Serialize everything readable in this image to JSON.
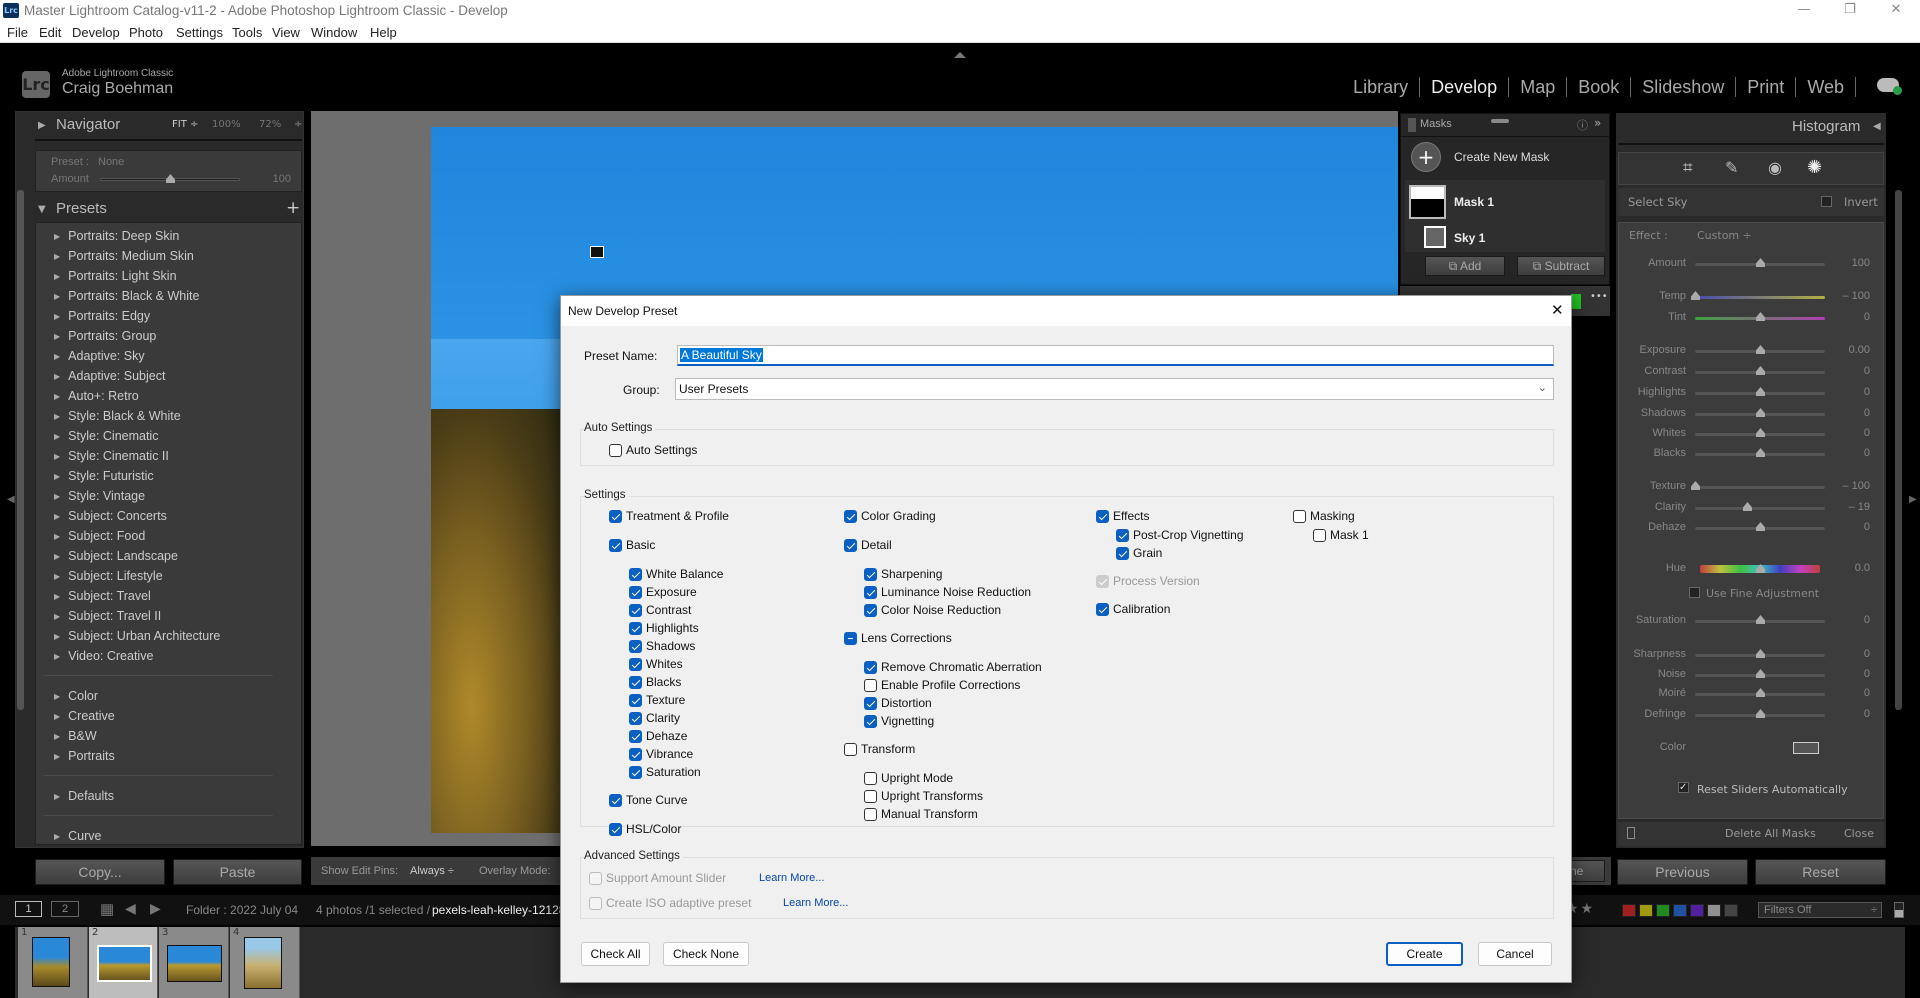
{
  "window": {
    "title": "Master Lightroom Catalog-v11-2 - Adobe Photoshop Lightroom Classic - Develop",
    "app_badge": "Lrc"
  },
  "menu": [
    "File",
    "Edit",
    "Develop",
    "Photo",
    "Settings",
    "Tools",
    "View",
    "Window",
    "Help"
  ],
  "identity": {
    "logo": "Lrc",
    "product": "Adobe Lightroom Classic",
    "user": "Craig Boehman"
  },
  "modules": [
    {
      "label": "Library"
    },
    {
      "label": "Develop",
      "active": true
    },
    {
      "label": "Map"
    },
    {
      "label": "Book"
    },
    {
      "label": "Slideshow"
    },
    {
      "label": "Print"
    },
    {
      "label": "Web"
    }
  ],
  "navigator": {
    "title": "Navigator",
    "fit": "FIT ÷",
    "z1": "100%",
    "z2": "72%",
    "zarrow": "÷"
  },
  "preset_amount": {
    "preset_label": "Preset :",
    "preset_value": "None",
    "amount_label": "Amount",
    "amount_value": "100",
    "amount_fraction": 0.5
  },
  "presets": {
    "title": "Presets",
    "add": "+",
    "items": [
      "Portraits: Deep Skin",
      "Portraits: Medium Skin",
      "Portraits: Light Skin",
      "Portraits: Black & White",
      "Portraits: Edgy",
      "Portraits: Group",
      "Adaptive: Sky",
      "Adaptive: Subject",
      "Auto+: Retro",
      "Style: Black & White",
      "Style: Cinematic",
      "Style: Cinematic II",
      "Style: Futuristic",
      "Style: Vintage",
      "Subject: Concerts",
      "Subject: Food",
      "Subject: Landscape",
      "Subject: Lifestyle",
      "Subject: Travel",
      "Subject: Travel II",
      "Subject: Urban Architecture",
      "Video: Creative"
    ],
    "groups2": [
      "Color",
      "Creative",
      "B&W",
      "Portraits"
    ],
    "groups3": [
      "Defaults"
    ],
    "groups4": [
      "Curve"
    ]
  },
  "left_buttons": {
    "copy": "Copy...",
    "paste": "Paste"
  },
  "toolbar": {
    "pins_label": "Show Edit Pins:",
    "pins_value": "Always ÷",
    "overlay_label": "Overlay Mode:",
    "done": "Done"
  },
  "masks": {
    "title": "Masks",
    "create": "Create New Mask",
    "mask1": "Mask 1",
    "sky1": "Sky 1",
    "add": "Add",
    "subtract": "Subtract",
    "more": "•••"
  },
  "right": {
    "histogram": "Histogram",
    "select": "Select Sky",
    "invert": "Invert",
    "effect_label": "Effect :",
    "effect_value": "Custom ÷",
    "sliders": [
      {
        "label": "Amount",
        "value": "100",
        "pos": 0.5,
        "track": "#555"
      },
      {
        "label": "Temp",
        "value": "– 100",
        "pos": 0.0,
        "track": "linear-gradient(90deg,#4a4ab0,#b0b040)"
      },
      {
        "label": "Tint",
        "value": "0",
        "pos": 0.5,
        "track": "linear-gradient(90deg,#40a040,#b040b0)"
      },
      {
        "label": "Exposure",
        "value": "0.00",
        "pos": 0.5,
        "track": "#555"
      },
      {
        "label": "Contrast",
        "value": "0",
        "pos": 0.5,
        "track": "#555"
      },
      {
        "label": "Highlights",
        "value": "0",
        "pos": 0.5,
        "track": "#555"
      },
      {
        "label": "Shadows",
        "value": "0",
        "pos": 0.5,
        "track": "#555"
      },
      {
        "label": "Whites",
        "value": "0",
        "pos": 0.5,
        "track": "#555"
      },
      {
        "label": "Blacks",
        "value": "0",
        "pos": 0.5,
        "track": "#555"
      },
      {
        "label": "Texture",
        "value": "– 100",
        "pos": 0.0,
        "track": "#555"
      },
      {
        "label": "Clarity",
        "value": "– 19",
        "pos": 0.4,
        "track": "#555"
      },
      {
        "label": "Dehaze",
        "value": "0",
        "pos": 0.5,
        "track": "#555"
      },
      {
        "label": "Hue",
        "value": "0.0",
        "pos": 0.5,
        "track": "linear-gradient(90deg,#c04040,#c0c040,#40c040,#40c0c0,#4040c0,#c040c0,#c04040)"
      },
      {
        "label": "Saturation",
        "value": "0",
        "pos": 0.5,
        "track": "#555"
      },
      {
        "label": "Sharpness",
        "value": "0",
        "pos": 0.5,
        "track": "#555"
      },
      {
        "label": "Noise",
        "value": "0",
        "pos": 0.5,
        "track": "#555"
      },
      {
        "label": "Moiré",
        "value": "0",
        "pos": 0.5,
        "track": "#555"
      },
      {
        "label": "Defringe",
        "value": "0",
        "pos": 0.5,
        "track": "#555"
      }
    ],
    "fine": "Use Fine Adjustment",
    "color_label": "Color",
    "reset_auto": "Reset Sliders Automatically",
    "delete_all": "Delete All Masks",
    "close": "Close",
    "previous": "Previous",
    "reset": "Reset"
  },
  "filmstrip": {
    "folder": "Folder : 2022 July 04",
    "count": "4 photos /1 selected /",
    "file": "pexels-leah-kelley-121283",
    "filters": "Filters Off",
    "v1": "1",
    "v2": "2",
    "cells": [
      "1",
      "2",
      "3",
      "4"
    ],
    "swatches": [
      "#a02020",
      "#a09a10",
      "#208a20",
      "#2050a0",
      "#5020a0",
      "#909090",
      "#444444"
    ]
  },
  "dialog": {
    "title": "New Develop Preset",
    "name_label": "Preset Name:",
    "name_value": "A Beautiful Sky",
    "group_label": "Group:",
    "group_value": "User Presets",
    "auto_group": "Auto Settings",
    "auto_cb": {
      "label": "Auto Settings",
      "state": "unchecked"
    },
    "settings_group": "Settings",
    "columns": [
      [
        {
          "label": "Treatment & Profile",
          "state": "checked"
        },
        {
          "label": "Basic",
          "state": "checked",
          "children": [
            {
              "label": "White Balance",
              "state": "checked"
            },
            {
              "label": "Exposure",
              "state": "checked"
            },
            {
              "label": "Contrast",
              "state": "checked"
            },
            {
              "label": "Highlights",
              "state": "checked"
            },
            {
              "label": "Shadows",
              "state": "checked"
            },
            {
              "label": "Whites",
              "state": "checked"
            },
            {
              "label": "Blacks",
              "state": "checked"
            },
            {
              "label": "Texture",
              "state": "checked"
            },
            {
              "label": "Clarity",
              "state": "checked"
            },
            {
              "label": "Dehaze",
              "state": "checked"
            },
            {
              "label": "Vibrance",
              "state": "checked"
            },
            {
              "label": "Saturation",
              "state": "checked"
            }
          ]
        },
        {
          "label": "Tone Curve",
          "state": "checked"
        },
        {
          "label": "HSL/Color",
          "state": "checked"
        }
      ],
      [
        {
          "label": "Color Grading",
          "state": "checked"
        },
        {
          "label": "Detail",
          "state": "checked",
          "children": [
            {
              "label": "Sharpening",
              "state": "checked"
            },
            {
              "label": "Luminance Noise Reduction",
              "state": "checked"
            },
            {
              "label": "Color Noise Reduction",
              "state": "checked"
            }
          ]
        },
        {
          "label": "Lens Corrections",
          "state": "indeterminate",
          "children": [
            {
              "label": "Remove Chromatic Aberration",
              "state": "checked"
            },
            {
              "label": "Enable Profile Corrections",
              "state": "unchecked"
            },
            {
              "label": "Distortion",
              "state": "checked"
            },
            {
              "label": "Vignetting",
              "state": "checked"
            }
          ]
        },
        {
          "label": "Transform",
          "state": "unchecked",
          "children": [
            {
              "label": "Upright Mode",
              "state": "unchecked"
            },
            {
              "label": "Upright Transforms",
              "state": "unchecked"
            },
            {
              "label": "Manual Transform",
              "state": "unchecked"
            }
          ]
        }
      ],
      [
        {
          "label": "Effects",
          "state": "checked",
          "children": [
            {
              "label": "Post-Crop Vignetting",
              "state": "checked"
            },
            {
              "label": "Grain",
              "state": "checked"
            }
          ]
        },
        {
          "label": "Process Version",
          "state": "disabled-checked"
        },
        {
          "label": "Calibration",
          "state": "checked"
        }
      ],
      [
        {
          "label": "Masking",
          "state": "unchecked",
          "tight": true,
          "children": [
            {
              "label": "Mask 1",
              "state": "unchecked"
            }
          ]
        }
      ]
    ],
    "advanced_group": "Advanced Settings",
    "support_amount": {
      "label": "Support Amount Slider",
      "state": "disabled",
      "link": "Learn More..."
    },
    "iso": {
      "label": "Create ISO adaptive preset",
      "state": "disabled",
      "link": "Learn More..."
    },
    "check_all": "Check All",
    "check_none": "Check None",
    "create": "Create",
    "cancel": "Cancel",
    "close": "✕"
  },
  "colors": {
    "accent": "#0a60c2",
    "selection": "#0078d7",
    "mask_green": "#22c022"
  }
}
